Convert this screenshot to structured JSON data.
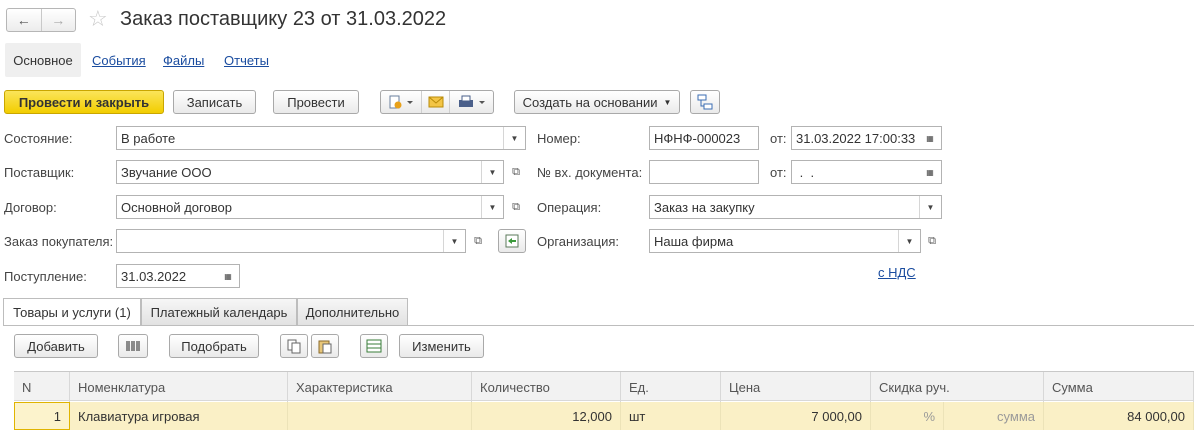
{
  "window": {
    "title": "Заказ поставщику 23 от 31.03.2022"
  },
  "nav": {
    "back_icon": "←",
    "forward_icon": "→",
    "favorite_icon": "☆"
  },
  "sections": {
    "main": "Основное",
    "events": "События",
    "files": "Файлы",
    "reports": "Отчеты"
  },
  "toolbar": {
    "post_close": "Провести и закрыть",
    "save": "Записать",
    "post": "Провести",
    "create_based": "Создать на основании"
  },
  "form": {
    "state_label": "Состояние:",
    "state_value": "В работе",
    "supplier_label": "Поставщик:",
    "supplier_value": "Звучание ООО",
    "contract_label": "Договор:",
    "contract_value": "Основной договор",
    "customer_order_label": "Заказ покупателя:",
    "customer_order_value": "",
    "receipt_label": "Поступление:",
    "receipt_value": "31.03.2022",
    "number_label": "Номер:",
    "number_value": "НФНФ-000023",
    "from_label": "от:",
    "date_value": "31.03.2022 17:00:33",
    "incoming_doc_label": "№ вх. документа:",
    "incoming_doc_value": "",
    "from2_label": "от:",
    "incoming_date_value": " .  .",
    "operation_label": "Операция:",
    "operation_value": "Заказ на закупку",
    "org_label": "Организация:",
    "org_value": "Наша фирма",
    "vat_link": "с НДС"
  },
  "tabs": [
    "Товары и услуги (1)",
    "Платежный календарь",
    "Дополнительно"
  ],
  "table_toolbar": {
    "add": "Добавить",
    "pick": "Подобрать",
    "change": "Изменить"
  },
  "table": {
    "headers": [
      "N",
      "Номенклатура",
      "Характеристика",
      "Количество",
      "Ед.",
      "Цена",
      "Скидка руч.",
      "Сумма"
    ],
    "rows": [
      {
        "n": "1",
        "item": "Клавиатура игровая",
        "feature": "",
        "qty": "12,000",
        "unit": "шт",
        "price": "7 000,00",
        "disc_pct": "%",
        "disc_sum": "сумма",
        "sum": "84 000,00"
      }
    ]
  },
  "colors": {
    "accent_yellow": "#f5d11a",
    "link": "#1a4c9f",
    "row_highlight": "#faf0c6"
  }
}
